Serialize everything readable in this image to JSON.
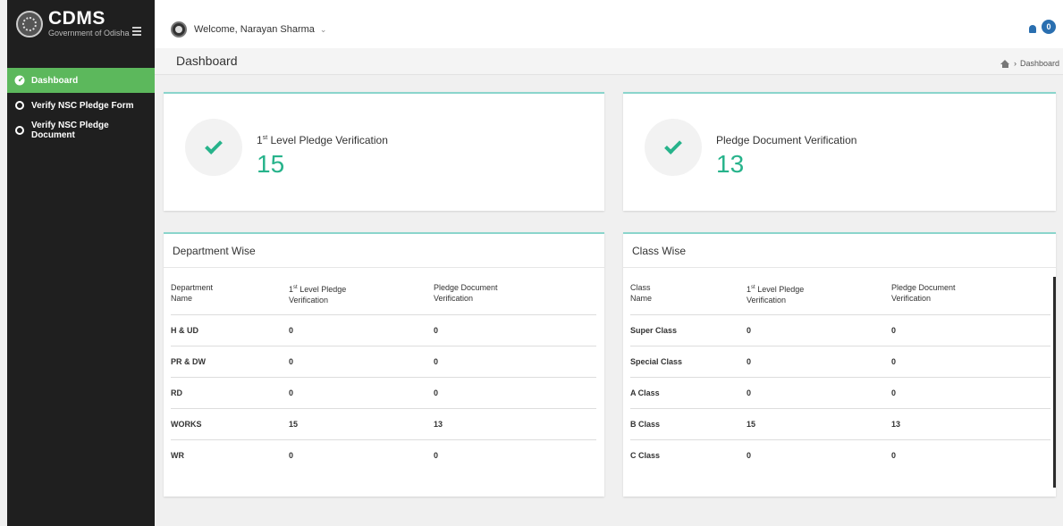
{
  "brand": {
    "title": "CDMS",
    "subtitle": "Government of Odisha"
  },
  "sidebar": {
    "items": [
      {
        "label": "Dashboard",
        "icon": "dashboard-icon",
        "active": true
      },
      {
        "label": "Verify NSC Pledge Form",
        "icon": "circle-icon",
        "active": false
      },
      {
        "label": "Verify NSC Pledge Document",
        "icon": "circle-icon",
        "active": false
      }
    ]
  },
  "topbar": {
    "welcome": "Welcome, Narayan Sharma",
    "notification_count": "0"
  },
  "page": {
    "title": "Dashboard",
    "breadcrumb": "Dashboard"
  },
  "stats": [
    {
      "label_prefix": "1",
      "label_sup": "st",
      "label_suffix": " Level Pledge Verification",
      "value": "15"
    },
    {
      "label_prefix": "",
      "label_sup": "",
      "label_suffix": "Pledge Document Verification",
      "value": "13"
    }
  ],
  "department": {
    "title": "Department Wise",
    "headers": {
      "col1a": "Department",
      "col1b": "Name",
      "col2a_pre": "1",
      "col2a_sup": "st",
      "col2a_post": " Level Pledge",
      "col2b": "Verification",
      "col3a": "Pledge Document",
      "col3b": "Verification"
    },
    "rows": [
      [
        "H & UD",
        "0",
        "0"
      ],
      [
        "PR & DW",
        "0",
        "0"
      ],
      [
        "RD",
        "0",
        "0"
      ],
      [
        "WORKS",
        "15",
        "13"
      ],
      [
        "WR",
        "0",
        "0"
      ]
    ]
  },
  "class": {
    "title": "Class Wise",
    "headers": {
      "col1a": "Class",
      "col1b": "Name",
      "col2a_pre": "1",
      "col2a_sup": "st",
      "col2a_post": " Level Pledge",
      "col2b": "Verification",
      "col3a": "Pledge Document",
      "col3b": "Verification"
    },
    "rows": [
      [
        "Super Class",
        "0",
        "0"
      ],
      [
        "Special Class",
        "0",
        "0"
      ],
      [
        "A Class",
        "0",
        "0"
      ],
      [
        "B Class",
        "15",
        "13"
      ],
      [
        "C Class",
        "0",
        "0"
      ]
    ]
  },
  "colors": {
    "accent_green": "#5cb85c",
    "value_teal": "#27b38b",
    "card_border": "#8ad5cc",
    "sidebar_bg": "#1f1f1f"
  }
}
